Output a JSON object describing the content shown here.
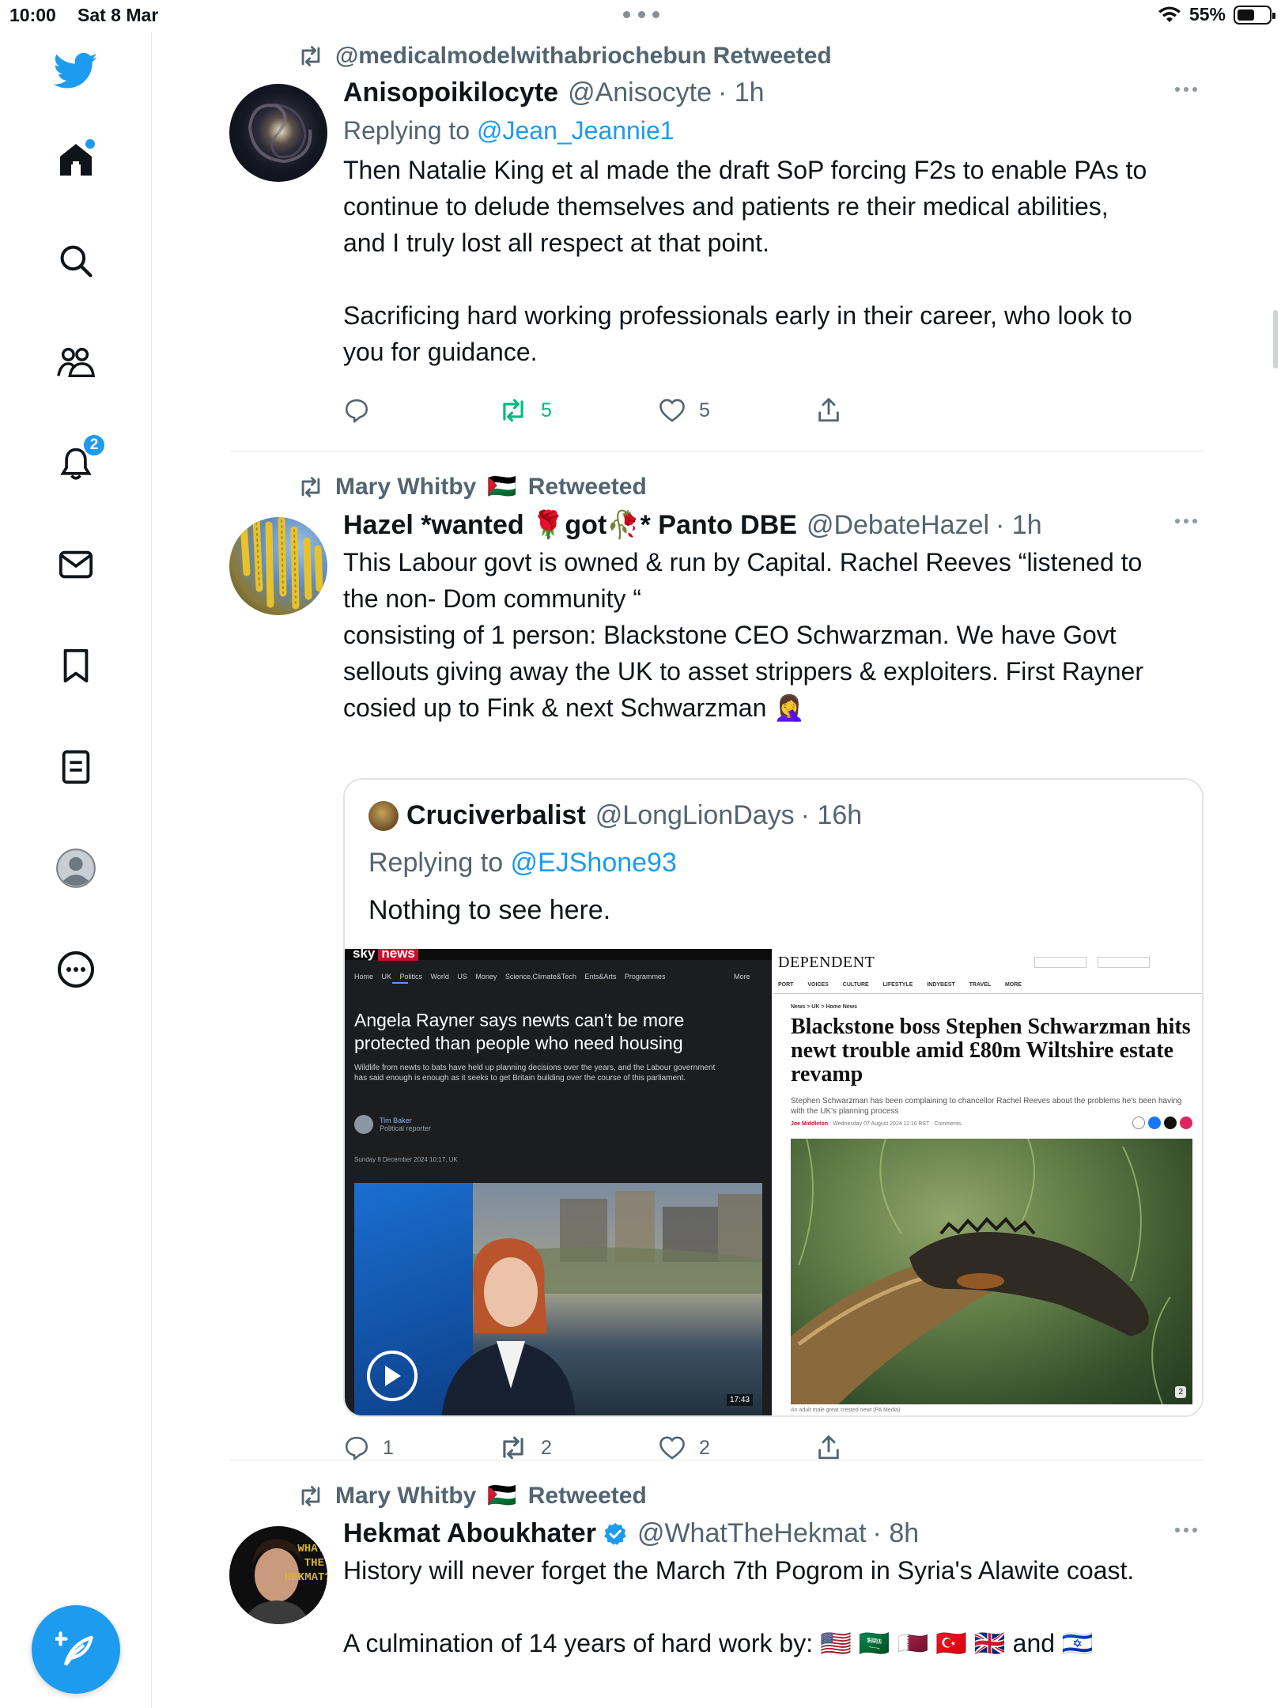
{
  "status_bar": {
    "time": "10:00",
    "date": "Sat 8 Mar",
    "battery": "55%",
    "battery_level": 0.55
  },
  "sidebar": {
    "items": [
      {
        "name": "home",
        "icon": "home-icon",
        "has_dot": true
      },
      {
        "name": "explore",
        "icon": "search-icon"
      },
      {
        "name": "communities",
        "icon": "communities-icon"
      },
      {
        "name": "notifications",
        "icon": "bell-icon",
        "badge": "2"
      },
      {
        "name": "messages",
        "icon": "envelope-icon"
      },
      {
        "name": "bookmarks",
        "icon": "bookmark-icon"
      },
      {
        "name": "lists",
        "icon": "list-icon"
      },
      {
        "name": "profile",
        "icon": "profile-icon"
      },
      {
        "name": "more",
        "icon": "more-icon"
      }
    ],
    "compose_icon": "compose-icon"
  },
  "tweets": [
    {
      "retweeted_by": "@medicalmodelwithabriochebun Retweeted",
      "name": "Anisopoikilocyte",
      "handle": "@Anisocyte",
      "time": "· 1h",
      "replying_prefix": "Replying to ",
      "replying_to": "@Jean_Jeannie1",
      "text_lines": [
        "Then Natalie King et al made the draft SoP forcing F2s to enable PAs to",
        "continue to delude themselves and patients re their medical abilities,",
        "and I truly lost all respect at that point.",
        "",
        "Sacrificing hard working professionals early in their career, who look to",
        "you for guidance."
      ],
      "stats": {
        "replies": "",
        "retweets": "5",
        "likes": "5"
      }
    },
    {
      "retweeted_by_name": "Mary Whitby",
      "retweeted_by_flag": "🇵🇸",
      "retweeted_label": "Retweeted",
      "name": "Hazel *wanted 🌹got🥀* Panto DBE",
      "handle": "@DebateHazel",
      "time": "· 1h",
      "text_lines": [
        "This Labour govt is owned & run by Capital. Rachel Reeves “listened to",
        "the non- Dom community “",
        "consisting of 1 person:  Blackstone CEO Schwarzman.  We have Govt",
        "sellouts giving away the UK to asset strippers & exploiters.  First Rayner",
        "cosied up to Fink & next Schwarzman 🤦‍♀️"
      ],
      "quote": {
        "name": "Cruciverbalist",
        "handle": "@LongLionDays",
        "time": "· 16h",
        "replying_prefix": "Replying to ",
        "replying_to": "@EJShone93",
        "text": "Nothing to see here.",
        "sky": {
          "logo": "sky",
          "logo_tag": "news",
          "nav": "Home UK Politics World US Money Science,Climate&Tech Ents&Arts Programmes",
          "nav_more": "More",
          "headline": "Angela Rayner says newts can't be more protected than people who need housing",
          "standfirst": "Wildlife from newts to bats have held up planning decisions over the years, and the Labour government has said enough is enough as it seeks to get Britain building over the course of this parliament.",
          "author": "Tim Baker",
          "author_role": "Political reporter",
          "date": "Sunday 8 December 2024 10:17, UK",
          "duration": "17:43"
        },
        "independent": {
          "logo": "DEPENDENT",
          "nav": "PORT VOICES CULTURE LIFESTYLE INDYBEST TRAVEL MORE",
          "crumb": "News > UK > Home News",
          "headline": "Blackstone boss Stephen Schwarzman hits newt trouble amid £80m Wiltshire estate revamp",
          "standfirst": "Stephen Schwarzman has been complaining to chancellor Rachel Reeves about the problems he's been having with the UK's planning process",
          "author": "Joe Middleton",
          "date": "Wednesday 07 August 2024 11:16 BST",
          "comments": "Comments",
          "caption": "An adult male great crested newt (PA Media)",
          "photo_count": "2"
        }
      },
      "stats": {
        "replies": "1",
        "retweets": "2",
        "likes": "2"
      }
    },
    {
      "retweeted_by_name": "Mary Whitby",
      "retweeted_by_flag": "🇵🇸",
      "retweeted_label": "Retweeted",
      "name": "Hekmat Aboukhater",
      "verified": true,
      "handle": "@WhatTheHekmat",
      "time": "· 8h",
      "avatar_text": "WHAT THE HEKMAT?",
      "text_lines": [
        "History will never forget the March 7th Pogrom in Syria's Alawite coast.",
        "",
        "A culmination of 14 years of hard work by:  🇺🇸 🇸🇦 🇶🇦 🇹🇷 🇬🇧  and  🇮🇱"
      ]
    }
  ],
  "colors": {
    "accent": "#1d9bf0",
    "retweet_green": "#00ba7c",
    "secondary_text": "#536471"
  }
}
